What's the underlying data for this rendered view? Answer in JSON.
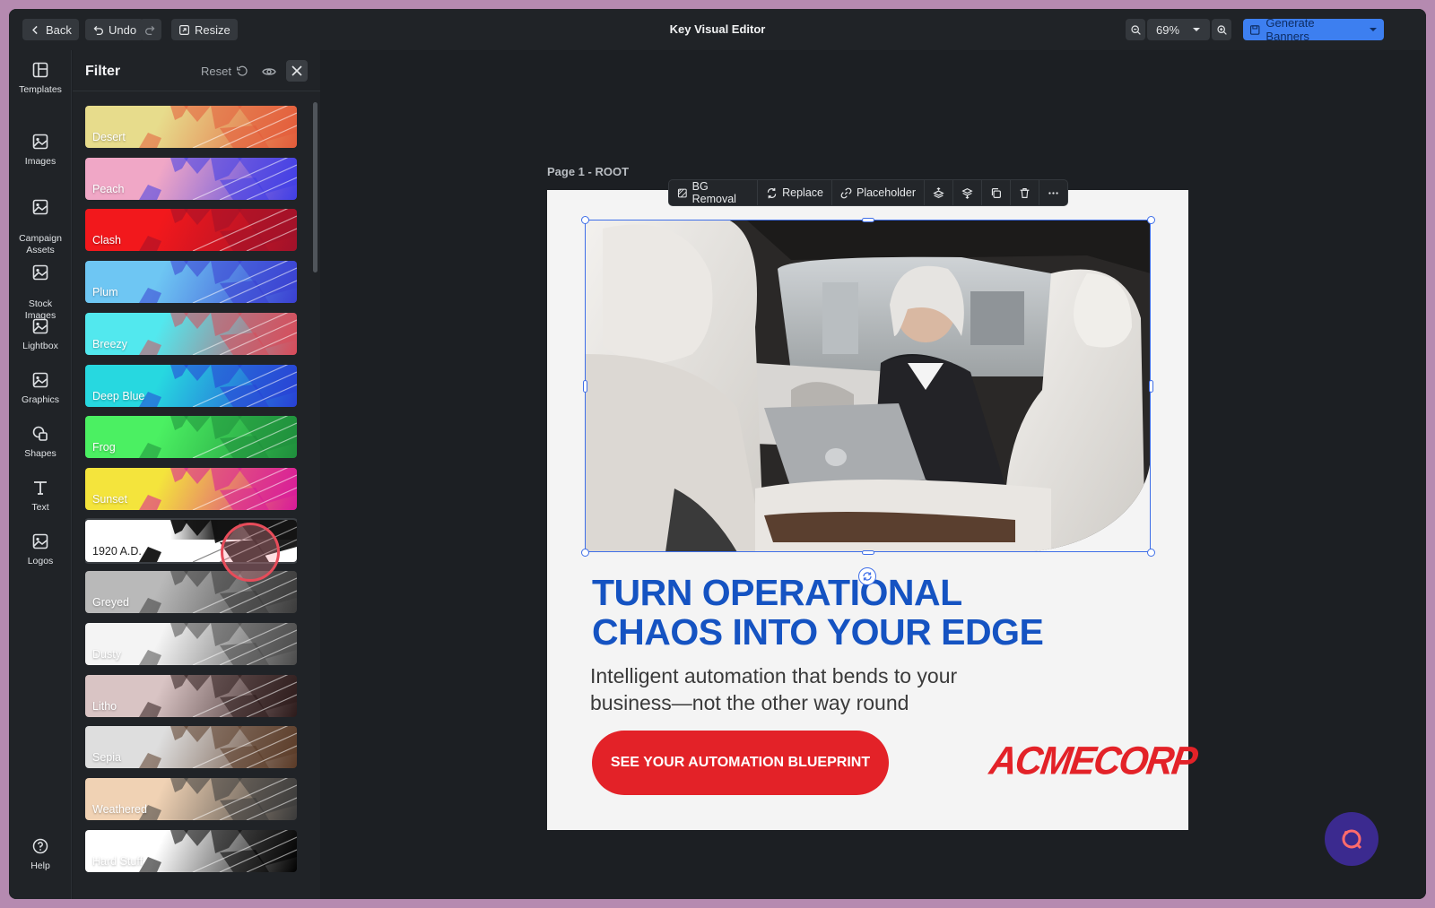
{
  "app": {
    "title": "Key Visual Editor"
  },
  "topbar": {
    "back_label": "Back",
    "undo_label": "Undo",
    "resize_label": "Resize",
    "zoom_value": "69%",
    "generate_label": "Generate Banners"
  },
  "rail": {
    "items": [
      {
        "label": "Templates",
        "icon": "templates-icon"
      },
      {
        "label": "Images",
        "icon": "image-icon"
      },
      {
        "label": "Campaign\nAssets",
        "icon": "image-icon"
      },
      {
        "label": "Stock\nImages",
        "icon": "image-icon"
      },
      {
        "label": "Lightbox",
        "icon": "image-icon"
      },
      {
        "label": "Graphics",
        "icon": "image-icon"
      },
      {
        "label": "Shapes",
        "icon": "shapes-icon"
      },
      {
        "label": "Text",
        "icon": "text-icon"
      },
      {
        "label": "Logos",
        "icon": "image-icon"
      }
    ],
    "help_label": "Help"
  },
  "filter_panel": {
    "title": "Filter",
    "reset_label": "Reset",
    "filters": [
      {
        "name": "Desert",
        "c1": "#e7dc8c",
        "c2": "#e35b3a"
      },
      {
        "name": "Peach",
        "c1": "#f0a7c6",
        "c2": "#3f3ee6"
      },
      {
        "name": "Clash",
        "c1": "#f2181c",
        "c2": "#a0122a"
      },
      {
        "name": "Plum",
        "c1": "#6ec6f3",
        "c2": "#3a3fd2"
      },
      {
        "name": "Breezy",
        "c1": "#52e8ee",
        "c2": "#d94a59"
      },
      {
        "name": "Deep Blue",
        "c1": "#27d8e0",
        "c2": "#2840d6"
      },
      {
        "name": "Frog",
        "c1": "#4bf062",
        "c2": "#1f8e3c"
      },
      {
        "name": "Sunset",
        "c1": "#f4e43c",
        "c2": "#d8199a"
      },
      {
        "name": "1920 A.D.",
        "c1": "#ffffff",
        "c2": "#111111"
      },
      {
        "name": "Greyed",
        "c1": "#b9b9b9",
        "c2": "#3b3b3b"
      },
      {
        "name": "Dusty",
        "c1": "#f4f4f4",
        "c2": "#4b4b4b"
      },
      {
        "name": "Litho",
        "c1": "#d9c4c4",
        "c2": "#2c1a1a"
      },
      {
        "name": "Sepia",
        "c1": "#dedede",
        "c2": "#5a3a26"
      },
      {
        "name": "Weathered",
        "c1": "#f0d2b4",
        "c2": "#3a3a3a"
      },
      {
        "name": "Hard Stuff",
        "c1": "#ffffff",
        "c2": "#000000"
      }
    ],
    "selected": "1920 A.D."
  },
  "canvas": {
    "page_label": "Page 1 - ROOT",
    "toolbar": {
      "bg_removal": "BG Removal",
      "replace": "Replace",
      "placeholder": "Placeholder"
    }
  },
  "banner": {
    "headline_line1": "TURN OPERATIONAL",
    "headline_line2": "CHAOS INTO YOUR EDGE",
    "subhead_line1": "Intelligent automation that bends to your",
    "subhead_line2": "business—not the other way round",
    "cta_label": "SEE YOUR AUTOMATION BLUEPRINT",
    "logo_text": "ACMECORP",
    "headline_color": "#1553c2",
    "cta_color": "#e32228"
  },
  "colors": {
    "accent": "#3d7ff0",
    "selection": "#3e6ee8"
  }
}
